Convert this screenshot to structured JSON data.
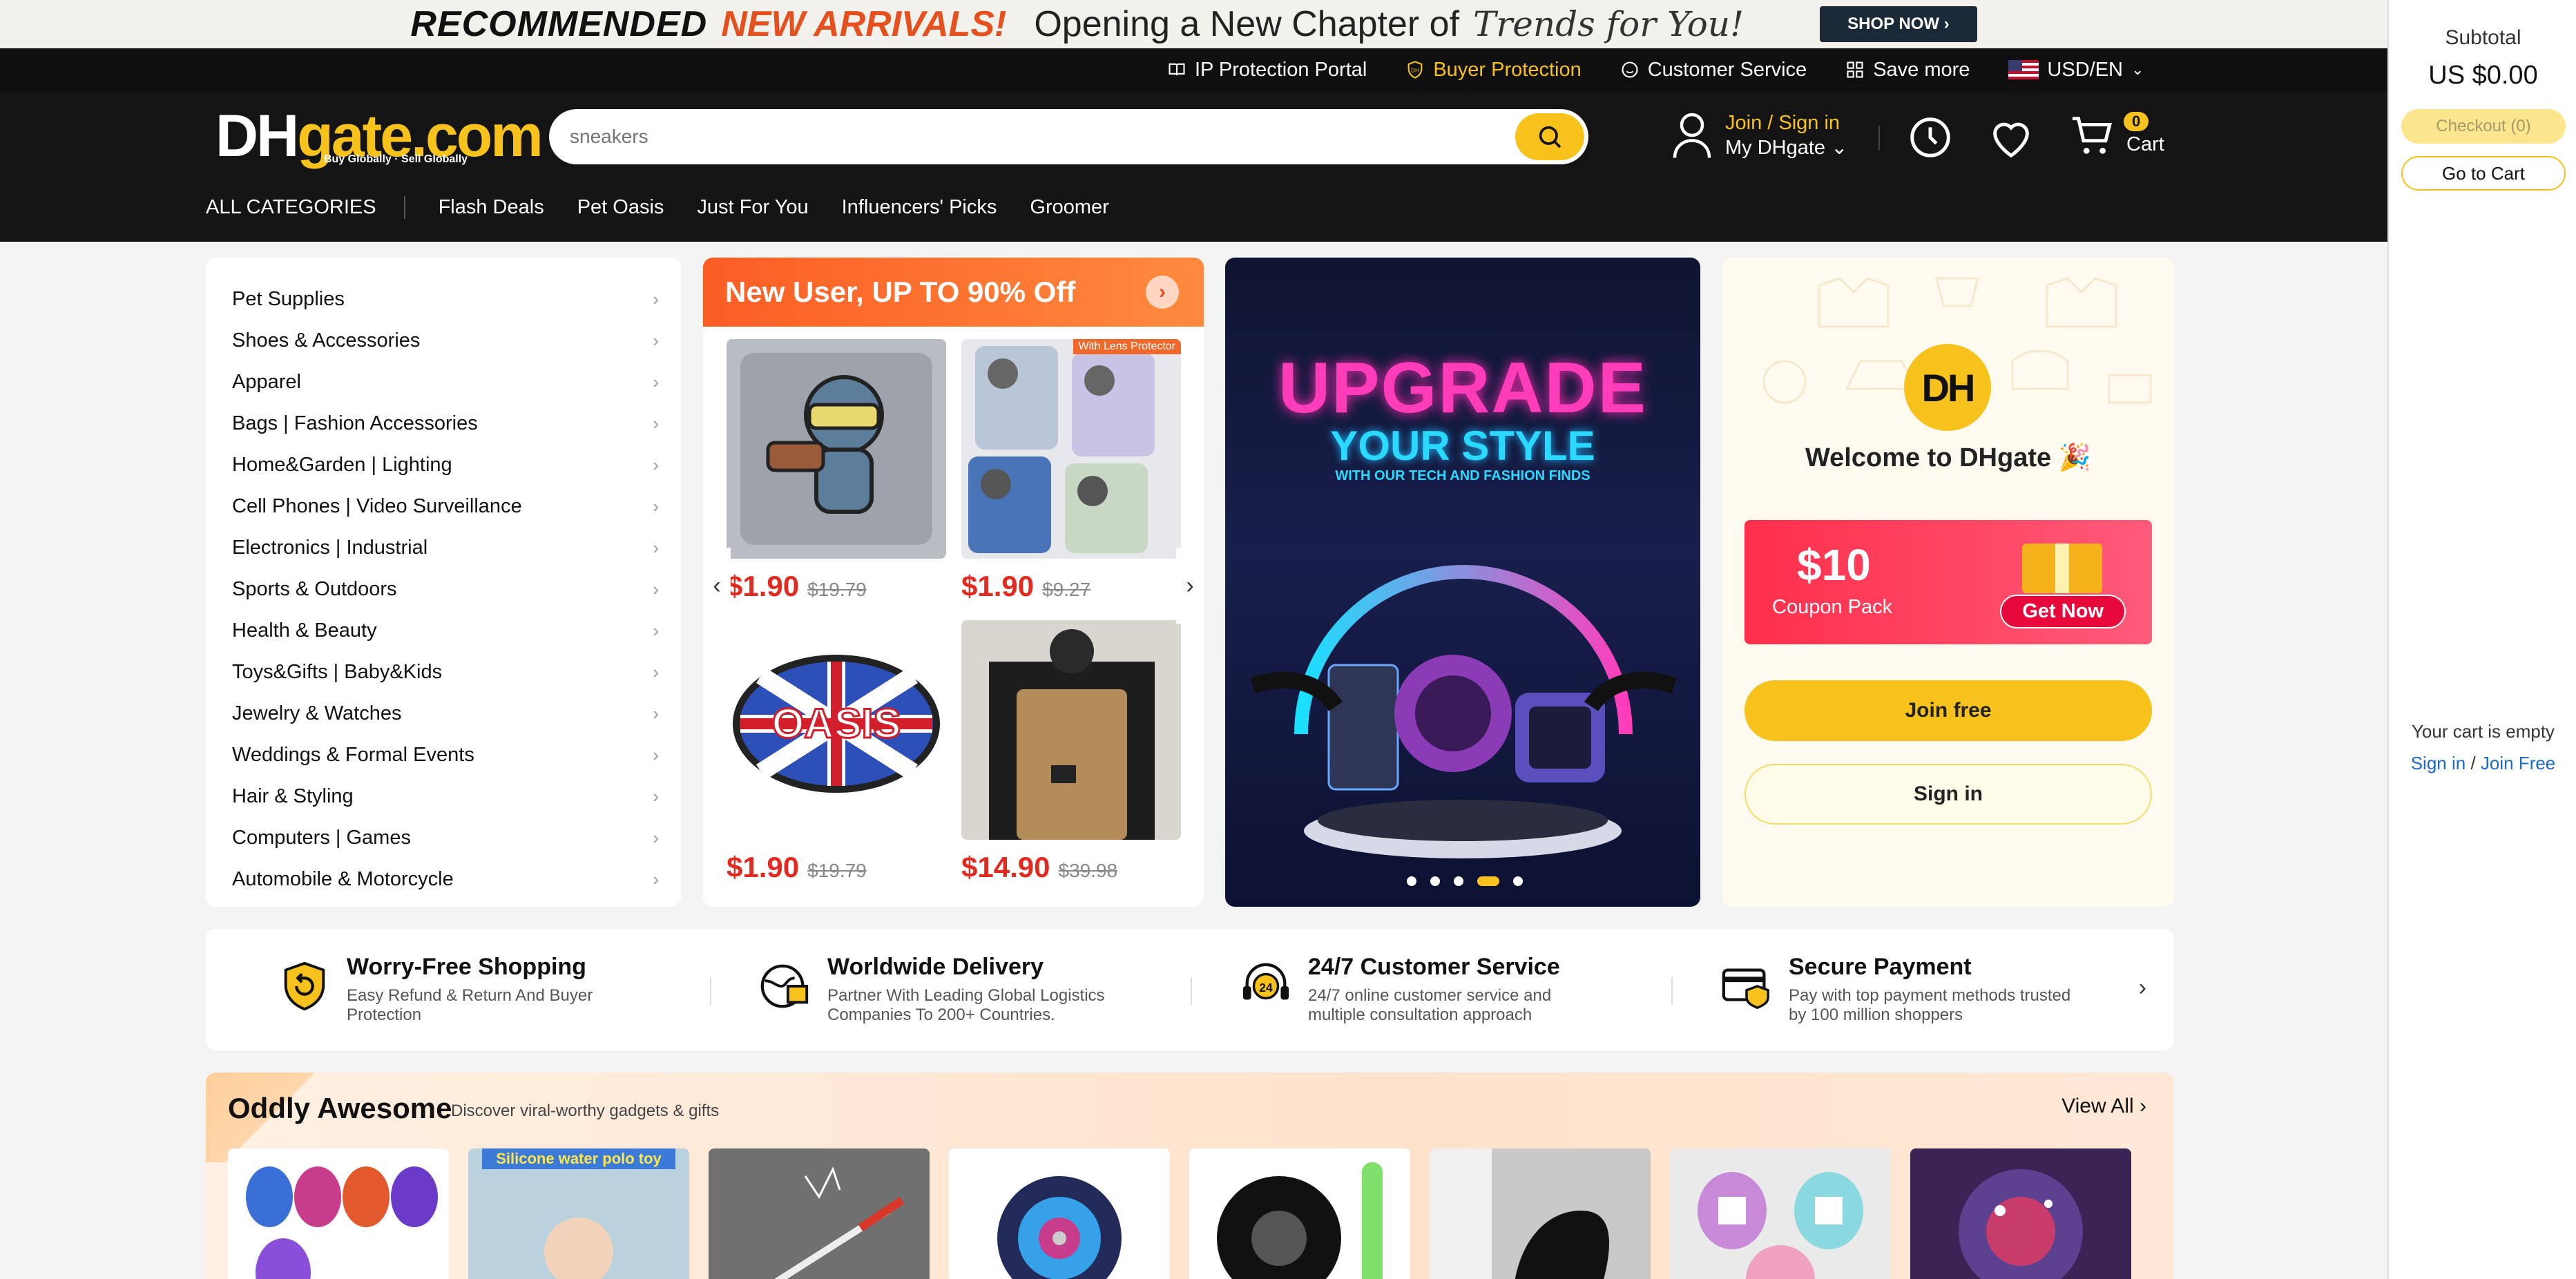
{
  "promo": {
    "recommended": "RECOMMENDED",
    "new_arrivals": "NEW ARRIVALS!",
    "chapter": "Opening a New Chapter of",
    "trends": "Trends for You!",
    "shop_now": "SHOP NOW ›"
  },
  "util": {
    "ip": "IP Protection Portal",
    "buyer": "Buyer Protection",
    "service": "Customer Service",
    "save": "Save more",
    "currency": "USD/EN"
  },
  "header": {
    "logo_dh": "DH",
    "logo_gate": "gate.com",
    "logo_tag": "Buy Globally · Sell Globally",
    "search_placeholder": "sneakers",
    "join": "Join / Sign in",
    "my": "My DHgate",
    "cart_count": "0",
    "cart_label": "Cart"
  },
  "nav": {
    "all": "ALL CATEGORIES",
    "items": [
      "Flash Deals",
      "Pet Oasis",
      "Just For You",
      "Influencers' Picks",
      "Groomer"
    ]
  },
  "categories": [
    "Pet Supplies",
    "Shoes & Accessories",
    "Apparel",
    "Bags | Fashion Accessories",
    "Home&Garden | Lighting",
    "Cell Phones | Video Surveillance",
    "Electronics | Industrial",
    "Sports & Outdoors",
    "Health & Beauty",
    "Toys&Gifts | Baby&Kids",
    "Jewelry & Watches",
    "Weddings & Formal Events",
    "Hair & Styling",
    "Computers | Games",
    "Automobile & Motorcycle"
  ],
  "new_user": {
    "title": "New User,  UP TO 90% Off",
    "products": [
      {
        "price": "$1.90",
        "old": "$19.79"
      },
      {
        "price": "$1.90",
        "old": "$9.27",
        "tag": "With Lens Protector"
      },
      {
        "price": "$1.90",
        "old": "$19.79"
      },
      {
        "price": "$14.90",
        "old": "$39.98"
      }
    ]
  },
  "hero": {
    "line1": "UPGRADE",
    "line2": "YOUR STYLE",
    "line3": "WITH OUR TECH AND FASHION FINDS"
  },
  "welcome": {
    "badge": "DH",
    "title": "Welcome to DHgate 🎉",
    "coupon_amount": "$10",
    "coupon_label": "Coupon Pack",
    "get_now": "Get Now",
    "join_free": "Join free",
    "sign_in": "Sign in"
  },
  "features": [
    {
      "title": "Worry-Free Shopping",
      "desc": "Easy Refund & Return And Buyer Protection"
    },
    {
      "title": "Worldwide Delivery",
      "desc": "Partner With Leading Global Logistics Companies To 200+ Countries."
    },
    {
      "title": "24/7 Customer Service",
      "desc": "24/7 online customer service and multiple consultation approach"
    },
    {
      "title": "Secure Payment",
      "desc": "Pay with top payment methods trusted by 100 million shoppers"
    }
  ],
  "oddly": {
    "title": "Oddly Awesome",
    "subtitle": "Discover viral-worthy gadgets & gifts",
    "view_all": "View All",
    "thumb2_tag": "Silicone water polo toy"
  },
  "cart_panel": {
    "subtotal": "Subtotal",
    "amount": "US $0.00",
    "checkout": "Checkout (0)",
    "go_to_cart": "Go to Cart",
    "empty": "Your cart is empty",
    "sign_in": "Sign in",
    "slash": " / ",
    "join_free": "Join Free"
  },
  "colors": {
    "brand_yellow": "#f6c21b",
    "header_bg": "#141414",
    "price_red": "#e12b21",
    "promo_orange": "#e5501f"
  }
}
